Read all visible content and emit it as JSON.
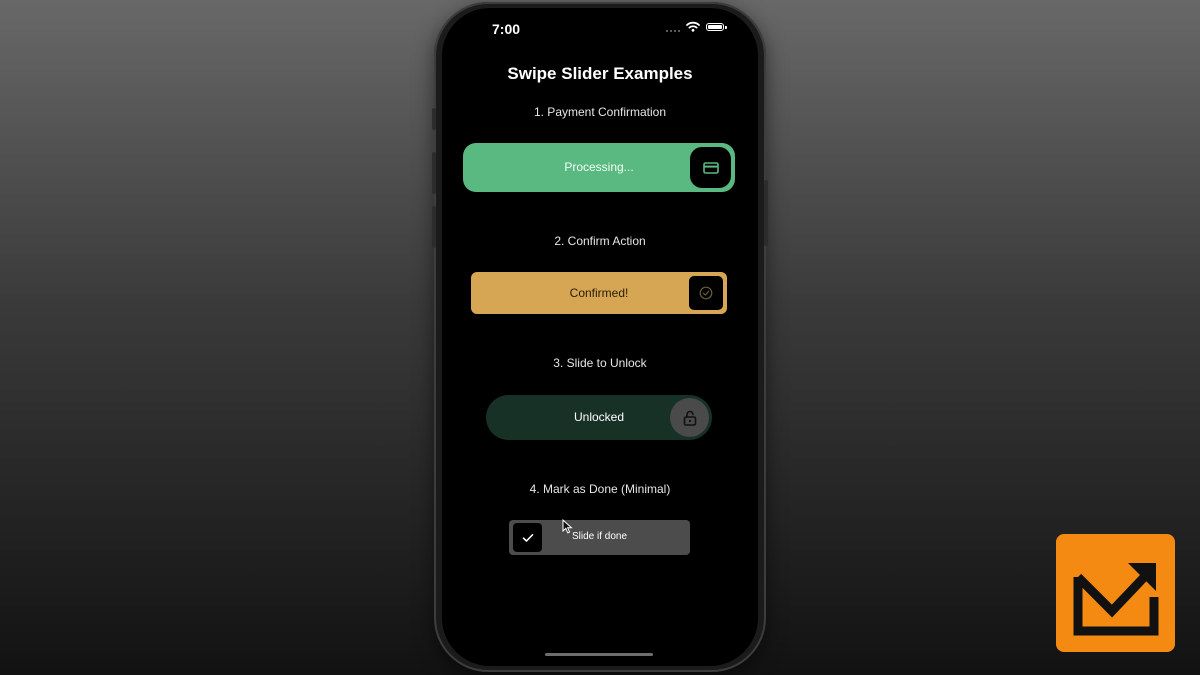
{
  "status_bar": {
    "time": "7:00"
  },
  "page": {
    "title": "Swipe Slider Examples"
  },
  "sections": [
    {
      "label": "1. Payment Confirmation",
      "slider_text": "Processing...",
      "knob_icon": "credit-card-icon",
      "track_color": "#5ab881"
    },
    {
      "label": "2. Confirm Action",
      "slider_text": "Confirmed!",
      "knob_icon": "check-circle-icon",
      "track_color": "#d6a654"
    },
    {
      "label": "3. Slide to Unlock",
      "slider_text": "Unlocked",
      "knob_icon": "unlock-icon",
      "track_color": "#183127"
    },
    {
      "label": "4. Mark as Done (Minimal)",
      "slider_text": "Slide if done",
      "knob_icon": "checkmark-icon",
      "track_color": "#4c4c4c"
    }
  ],
  "brand_logo": {
    "icon": "m-arrow-logo",
    "color": "#f58a12"
  }
}
